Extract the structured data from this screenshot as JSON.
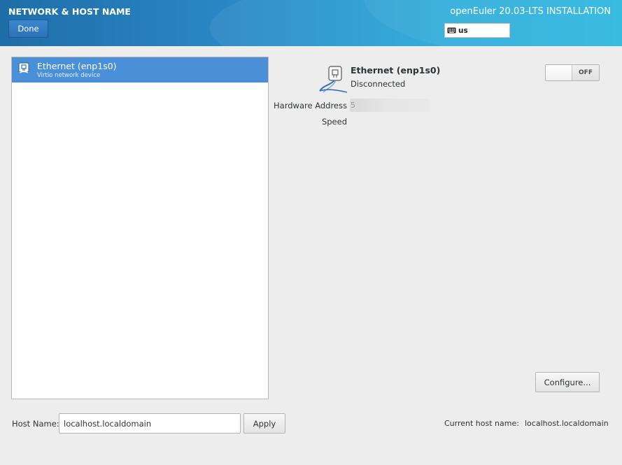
{
  "header": {
    "spoke_title": "NETWORK & HOST NAME",
    "done_label": "Done",
    "product_title": "openEuler 20.03-LTS INSTALLATION",
    "keyboard_layout": "us"
  },
  "device_list": {
    "items": [
      {
        "name": "Ethernet (enp1s0)",
        "description": "Virtio network device",
        "selected": true
      }
    ]
  },
  "details": {
    "device_name": "Ethernet (enp1s0)",
    "status": "Disconnected",
    "hardware_address_label": "Hardware Address",
    "hardware_address_value": "5",
    "speed_label": "Speed",
    "toggle_state": "OFF",
    "configure_label": "Configure..."
  },
  "hostname": {
    "label": "Host Name:",
    "value": "localhost.localdomain",
    "apply_label": "Apply",
    "current_label": "Current host name:",
    "current_value": "localhost.localdomain"
  },
  "colors": {
    "header_gradient_start": "#1e6ea8",
    "header_gradient_end": "#22b5df",
    "selection": "#4a90d9",
    "background": "#ededed"
  }
}
